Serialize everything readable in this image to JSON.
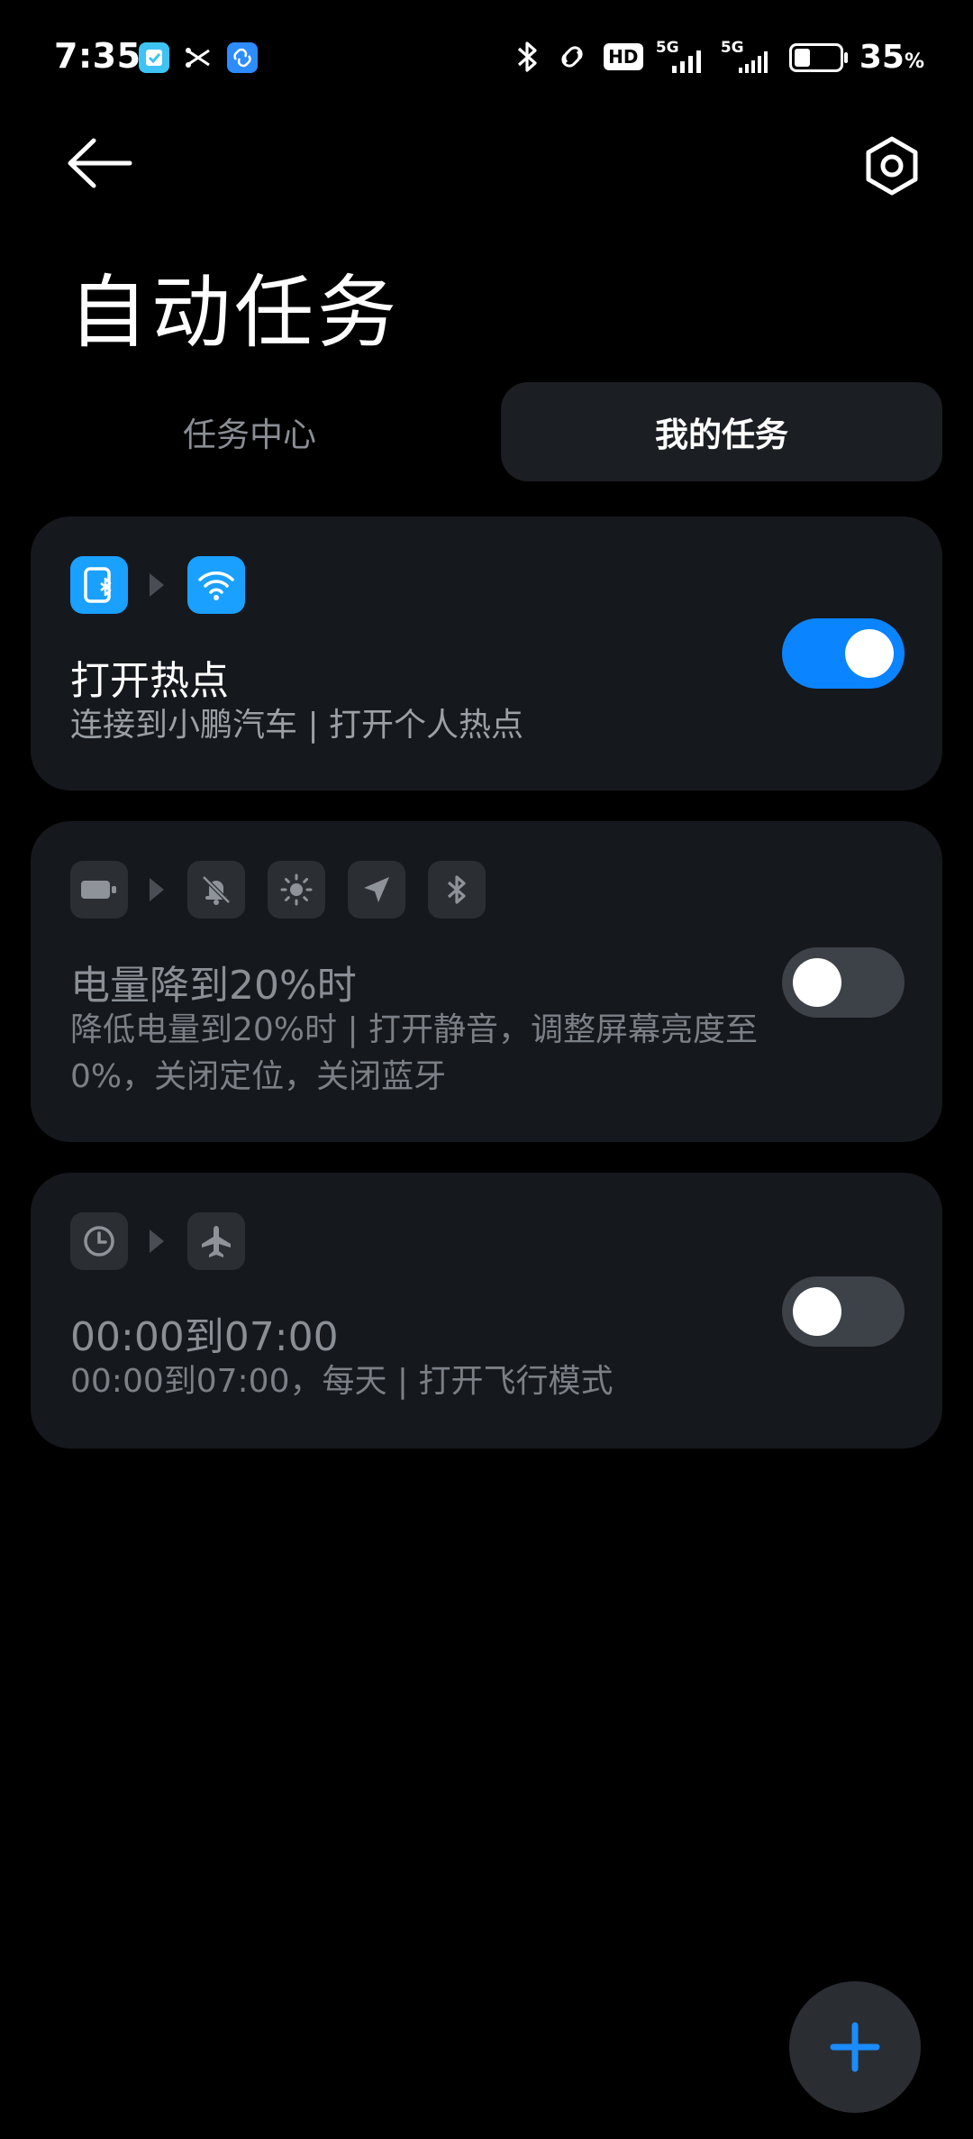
{
  "status_bar": {
    "time": "7:35",
    "battery_level": "35",
    "battery_percent_sign": "%",
    "battery_fill_fraction": 0.35,
    "network_labels": [
      "HD",
      "5G",
      "5G"
    ],
    "icons": [
      "calendar-app-icon",
      "scissors-icon",
      "link-app-icon",
      "bluetooth-icon",
      "link-icon",
      "hd-icon",
      "signal-5g-icon",
      "signal-5g-icon",
      "battery-icon"
    ]
  },
  "header": {
    "title": "自动任务",
    "back_icon": "arrow-left-icon",
    "settings_icon": "hexagon-gear-icon"
  },
  "tabs": [
    {
      "label": "任务中心",
      "selected": false
    },
    {
      "label": "我的任务",
      "selected": true
    }
  ],
  "tasks": [
    {
      "title": "打开热点",
      "subtitle": "连接到小鹏汽车 | 打开个人热点",
      "enabled": true,
      "trigger_icons": [
        "bluetooth-device-icon"
      ],
      "action_icons": [
        "hotspot-wifi-icon"
      ]
    },
    {
      "title": "电量降到20%时",
      "subtitle": "降低电量到20%时 | 打开静音，调整屏幕亮度至0%，关闭定位，关闭蓝牙",
      "enabled": false,
      "trigger_icons": [
        "battery-icon"
      ],
      "action_icons": [
        "mute-bell-icon",
        "brightness-icon",
        "location-icon",
        "bluetooth-icon"
      ]
    },
    {
      "title": "00:00到07:00",
      "subtitle": "00:00到07:00，每天 | 打开飞行模式",
      "enabled": false,
      "trigger_icons": [
        "clock-icon"
      ],
      "action_icons": [
        "airplane-icon"
      ]
    }
  ],
  "fab": {
    "icon": "plus-icon"
  },
  "colors": {
    "background": "#000000",
    "card": "#15181c",
    "accent": "#0a84ff",
    "icon_active": "#1aa0ff",
    "icon_inactive": "#2b2f34",
    "text_primary": "#ffffff",
    "text_secondary": "#9aa0a6",
    "text_disabled": "#8a8f96"
  }
}
